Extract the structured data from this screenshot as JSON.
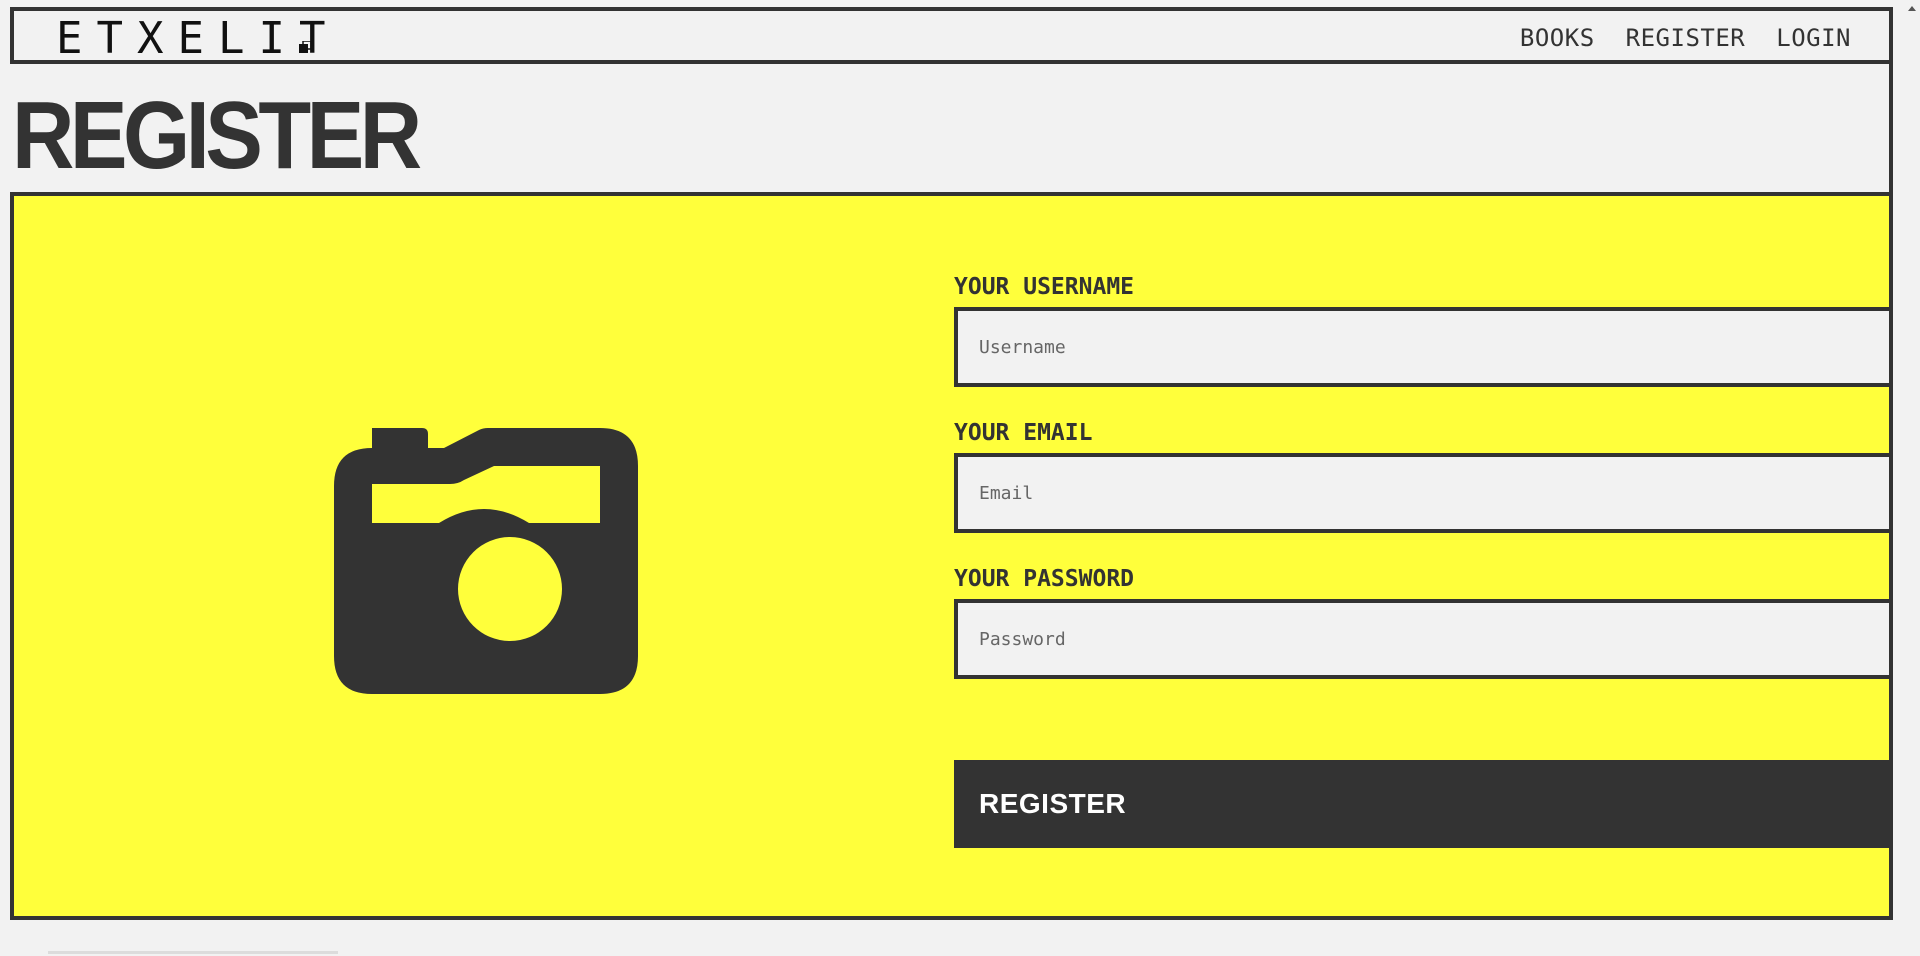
{
  "header": {
    "logo": "ETXELIT",
    "nav": [
      {
        "label": "BOOKS"
      },
      {
        "label": "REGISTER"
      },
      {
        "label": "LOGIN"
      }
    ]
  },
  "page": {
    "title": "REGISTER"
  },
  "form": {
    "username": {
      "label": "YOUR USERNAME",
      "placeholder": "Username",
      "value": ""
    },
    "email": {
      "label": "YOUR EMAIL",
      "placeholder": "Email",
      "value": ""
    },
    "password": {
      "label": "YOUR PASSWORD",
      "placeholder": "Password",
      "value": ""
    },
    "submit_label": "REGISTER"
  },
  "image": {
    "icon": "camera-icon"
  },
  "colors": {
    "accent": "#ffff3b",
    "dark": "#333333",
    "background": "#f2f2f2"
  }
}
